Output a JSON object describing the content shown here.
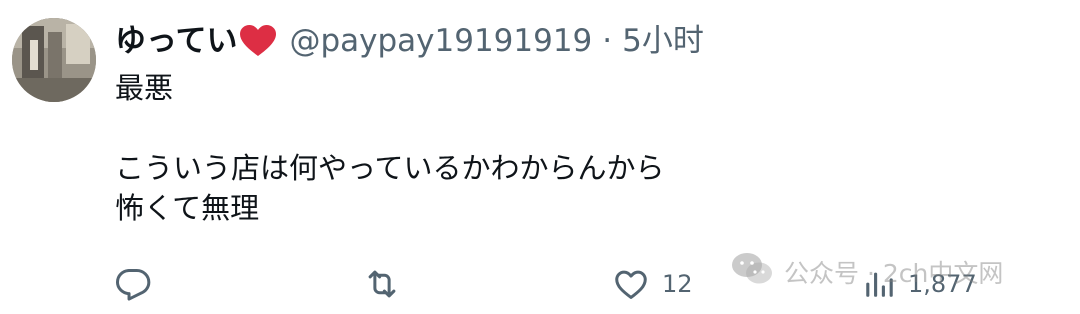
{
  "tweet": {
    "display_name": "ゆってい",
    "handle": "@paypay19191919",
    "separator": "·",
    "time": "5小时",
    "text_lines": [
      "最悪",
      "",
      "こういう店は何やっているかわからんから",
      "怖くて無理"
    ]
  },
  "actions": {
    "reply_icon": "reply-icon",
    "retweet_icon": "retweet-icon",
    "like_icon": "heart-outline-icon",
    "like_count": "12",
    "views_icon": "bar-chart-icon",
    "views_count": "1,877"
  },
  "watermark": {
    "icon": "wechat-icon",
    "text": "公众号 · 2ch中文网"
  },
  "colors": {
    "heart": "#e0245e",
    "secondary_text": "#536471",
    "primary_text": "#0f1419"
  }
}
